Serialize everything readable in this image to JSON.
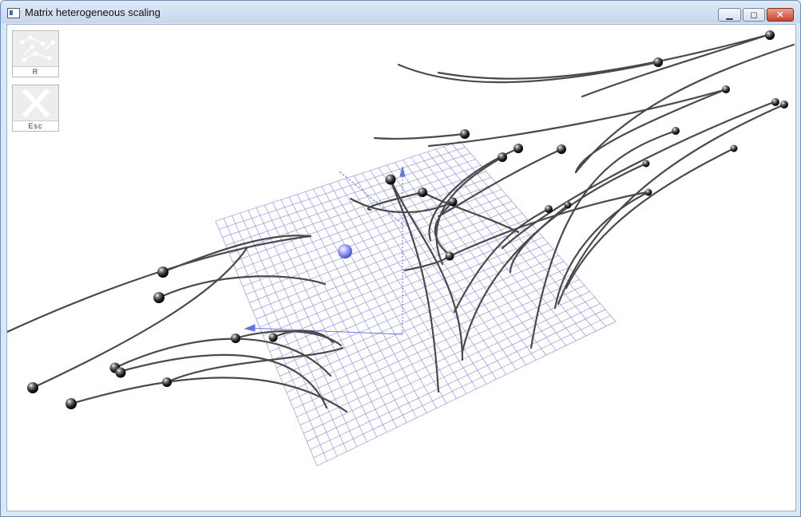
{
  "window": {
    "title": "Matrix heterogeneous scaling",
    "minimize_label": "▁",
    "maximize_label": "◻",
    "close_label": "✕"
  },
  "toolbar": {
    "reset_label": "R",
    "exit_label": "Esc"
  },
  "colors": {
    "grid": "#7f86ea",
    "curve": "#4a4a4a",
    "handle": "#8a8fff",
    "accent": "#5a6dd8"
  },
  "icons": {
    "reset": "scatter-nodes-icon",
    "exit": "close-x-icon"
  }
}
